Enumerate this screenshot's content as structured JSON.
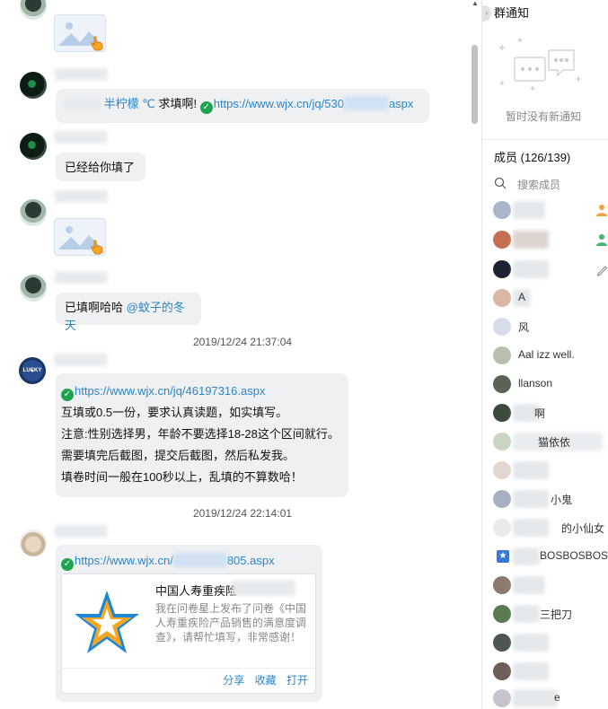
{
  "chat": {
    "messages": [
      {
        "type": "image"
      },
      {
        "type": "text",
        "sender_alias": "半柠檬 ℃",
        "text": "求填啊!",
        "link": "https://www.wjx.cn/jq/530",
        "link_tail": "aspx"
      },
      {
        "type": "text",
        "text": "已经给你填了"
      },
      {
        "type": "image"
      },
      {
        "type": "text",
        "text": "已填啊哈哈",
        "mention": "@蚊子的冬天"
      },
      {
        "type": "timestamp",
        "text": "2019/12/24 21:37:04"
      },
      {
        "type": "rich",
        "link": "https://www.wjx.cn/jq/46197316.aspx",
        "lines": [
          "互填或0.5一份，要求认真读题，如实填写。",
          "注意:性别选择男，年龄不要选择18-28这个区间就行。",
          "需要填完后截图，提交后截图，然后私发我。",
          "填卷时间一般在100秒以上，乱填的不算数哈！"
        ]
      },
      {
        "type": "timestamp",
        "text": "2019/12/24 22:14:01"
      },
      {
        "type": "card",
        "link_head": "https://www.wjx.cn/",
        "link_tail": "805.aspx",
        "card": {
          "title": "中国人寿重疾险",
          "desc": "我在问卷星上发布了问卷《中国人寿重疾险产品销售的满意度调查》，请帮忙填写，非常感谢！",
          "actions": [
            "分享",
            "收藏",
            "打开"
          ]
        }
      }
    ],
    "avatar_c_text": "LUCKY STRIKE",
    "verified_icon": "v-check-icon",
    "colors": {
      "link": "#2a86c9",
      "bubble": "#eef0f2",
      "verified": "#1ea44f"
    }
  },
  "side": {
    "notice_title": "群通知",
    "notice_empty": "暂时没有新通知",
    "members_title": "成员 (126/139)",
    "search_placeholder": "搜索成员",
    "members": [
      {
        "name": ""
      },
      {
        "name": ""
      },
      {
        "name": ""
      },
      {
        "name": "A"
      },
      {
        "name": "风"
      },
      {
        "name": "Aal izz well."
      },
      {
        "name": "llanson"
      },
      {
        "name": "啊"
      },
      {
        "name": "猫依依"
      },
      {
        "name": ""
      },
      {
        "name": "小鬼"
      },
      {
        "name": "的小仙女"
      },
      {
        "name": "BOSBOSBOS"
      },
      {
        "name": ""
      },
      {
        "name": "三把刀"
      },
      {
        "name": ""
      },
      {
        "name": ""
      },
      {
        "name": "e"
      }
    ]
  }
}
